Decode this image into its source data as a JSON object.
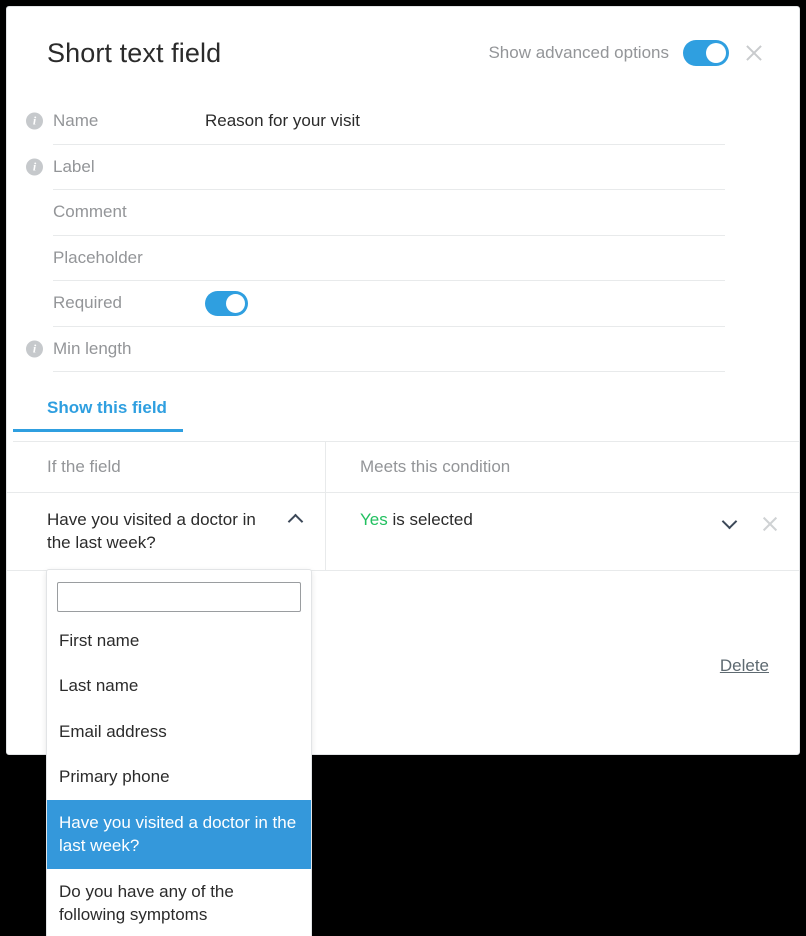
{
  "modal": {
    "title": "Short text field",
    "advanced_options_label": "Show advanced options",
    "advanced_options_on": true,
    "close_icon": "close-icon"
  },
  "properties": [
    {
      "label": "Name",
      "value": "Reason for your visit",
      "has_info": true,
      "type": "text"
    },
    {
      "label": "Label",
      "value": "",
      "has_info": true,
      "type": "text"
    },
    {
      "label": "Comment",
      "value": "",
      "has_info": false,
      "type": "text"
    },
    {
      "label": "Placeholder",
      "value": "",
      "has_info": false,
      "type": "text"
    },
    {
      "label": "Required",
      "value": "",
      "has_info": false,
      "type": "toggle",
      "toggle_on": true
    },
    {
      "label": "Min length",
      "value": "",
      "has_info": true,
      "type": "text"
    }
  ],
  "tabs": [
    {
      "label": "Show this field",
      "active": true
    }
  ],
  "conditions_table": {
    "headers": {
      "left": "If the field",
      "right": "Meets this condition"
    },
    "row": {
      "field": "Have you visited a doctor in the last week?",
      "condition_value": "Yes",
      "condition_rest": " is selected",
      "collapse_icon": "chevron-up-icon",
      "expand_icon": "chevron-down-icon",
      "remove_icon": "close-icon"
    }
  },
  "footer": {
    "delete_label": "Delete"
  },
  "dropdown": {
    "search_value": "",
    "search_placeholder": "",
    "options": [
      {
        "label": "First name",
        "selected": false
      },
      {
        "label": "Last name",
        "selected": false
      },
      {
        "label": "Email address",
        "selected": false
      },
      {
        "label": "Primary phone",
        "selected": false
      },
      {
        "label": "Have you visited a doctor in the last week?",
        "selected": true
      },
      {
        "label": "Do you have any of the following symptoms",
        "selected": false
      }
    ]
  },
  "colors": {
    "accent": "#2f9fe0",
    "selection": "#3498db",
    "success": "#22c060",
    "muted_text": "#939598",
    "body_text": "#2b2b2b",
    "divider": "#e8eaeb"
  }
}
